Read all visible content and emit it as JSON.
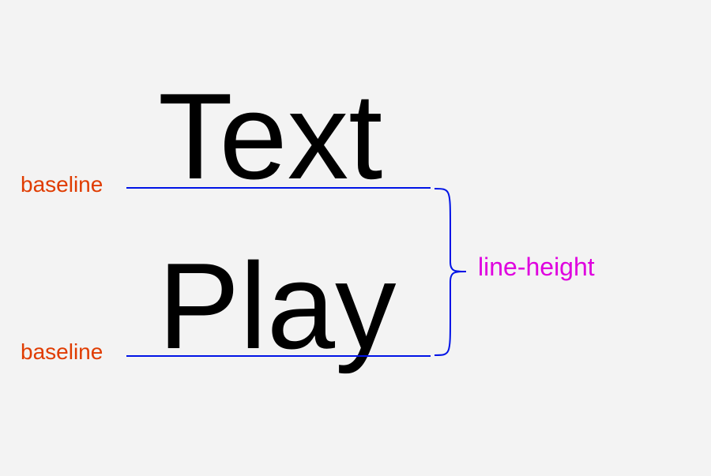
{
  "diagram": {
    "word1": "Text",
    "word2": "Play",
    "baseline_label_1": "baseline",
    "baseline_label_2": "baseline",
    "line_height_label": "line-height",
    "colors": {
      "baseline_line": "#0013e6",
      "baseline_label": "#e03c00",
      "line_height_label": "#df00df",
      "text": "#000000",
      "background": "#f3f3f3"
    }
  }
}
